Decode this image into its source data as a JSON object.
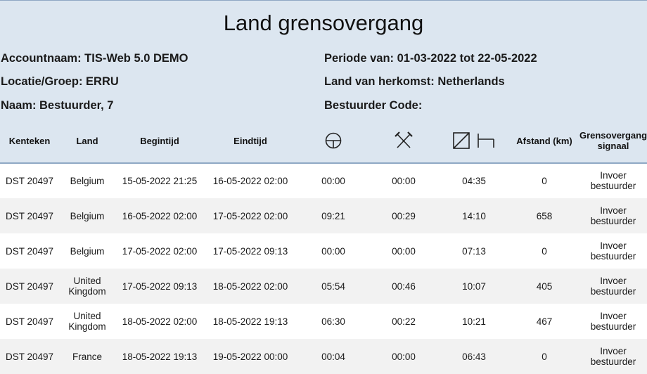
{
  "report": {
    "title": "Land grensovergang",
    "account": "Accountnaam: TIS-Web 5.0 DEMO",
    "location": "Locatie/Groep: ERRU",
    "name": "Naam: Bestuurder, 7",
    "period": "Periode van: 01-03-2022 tot 22-05-2022",
    "origin": "Land van herkomst: Netherlands",
    "driver_code": "Bestuurder Code:"
  },
  "columns": {
    "plate": "Kenteken",
    "country": "Land",
    "start": "Begintijd",
    "end": "Eindtijd",
    "drive_icon": "steering-wheel-icon",
    "work_icon": "crossed-hammers-icon",
    "avail_icon": "availability-icon",
    "rest_icon": "bed-icon",
    "distance": "Afstand (km)",
    "signal_line1": "Grensovergang",
    "signal_line2": "signaal"
  },
  "rows": [
    {
      "plate": "DST 20497",
      "country1": "Belgium",
      "country2": "",
      "start": "15-05-2022 21:25",
      "end": "16-05-2022 02:00",
      "drive": "00:00",
      "work": "00:00",
      "rest": "04:35",
      "distance": "0",
      "signal1": "Invoer",
      "signal2": "bestuurder"
    },
    {
      "plate": "DST 20497",
      "country1": "Belgium",
      "country2": "",
      "start": "16-05-2022 02:00",
      "end": "17-05-2022 02:00",
      "drive": "09:21",
      "work": "00:29",
      "rest": "14:10",
      "distance": "658",
      "signal1": "Invoer",
      "signal2": "bestuurder"
    },
    {
      "plate": "DST 20497",
      "country1": "Belgium",
      "country2": "",
      "start": "17-05-2022 02:00",
      "end": "17-05-2022 09:13",
      "drive": "00:00",
      "work": "00:00",
      "rest": "07:13",
      "distance": "0",
      "signal1": "Invoer",
      "signal2": "bestuurder"
    },
    {
      "plate": "DST 20497",
      "country1": "United",
      "country2": "Kingdom",
      "start": "17-05-2022 09:13",
      "end": "18-05-2022 02:00",
      "drive": "05:54",
      "work": "00:46",
      "rest": "10:07",
      "distance": "405",
      "signal1": "Invoer",
      "signal2": "bestuurder"
    },
    {
      "plate": "DST 20497",
      "country1": "United",
      "country2": "Kingdom",
      "start": "18-05-2022 02:00",
      "end": "18-05-2022 19:13",
      "drive": "06:30",
      "work": "00:22",
      "rest": "10:21",
      "distance": "467",
      "signal1": "Invoer",
      "signal2": "bestuurder"
    },
    {
      "plate": "DST 20497",
      "country1": "France",
      "country2": "",
      "start": "18-05-2022 19:13",
      "end": "19-05-2022 00:00",
      "drive": "00:04",
      "work": "00:00",
      "rest": "06:43",
      "distance": "0",
      "signal1": "Invoer",
      "signal2": "bestuurder"
    }
  ]
}
